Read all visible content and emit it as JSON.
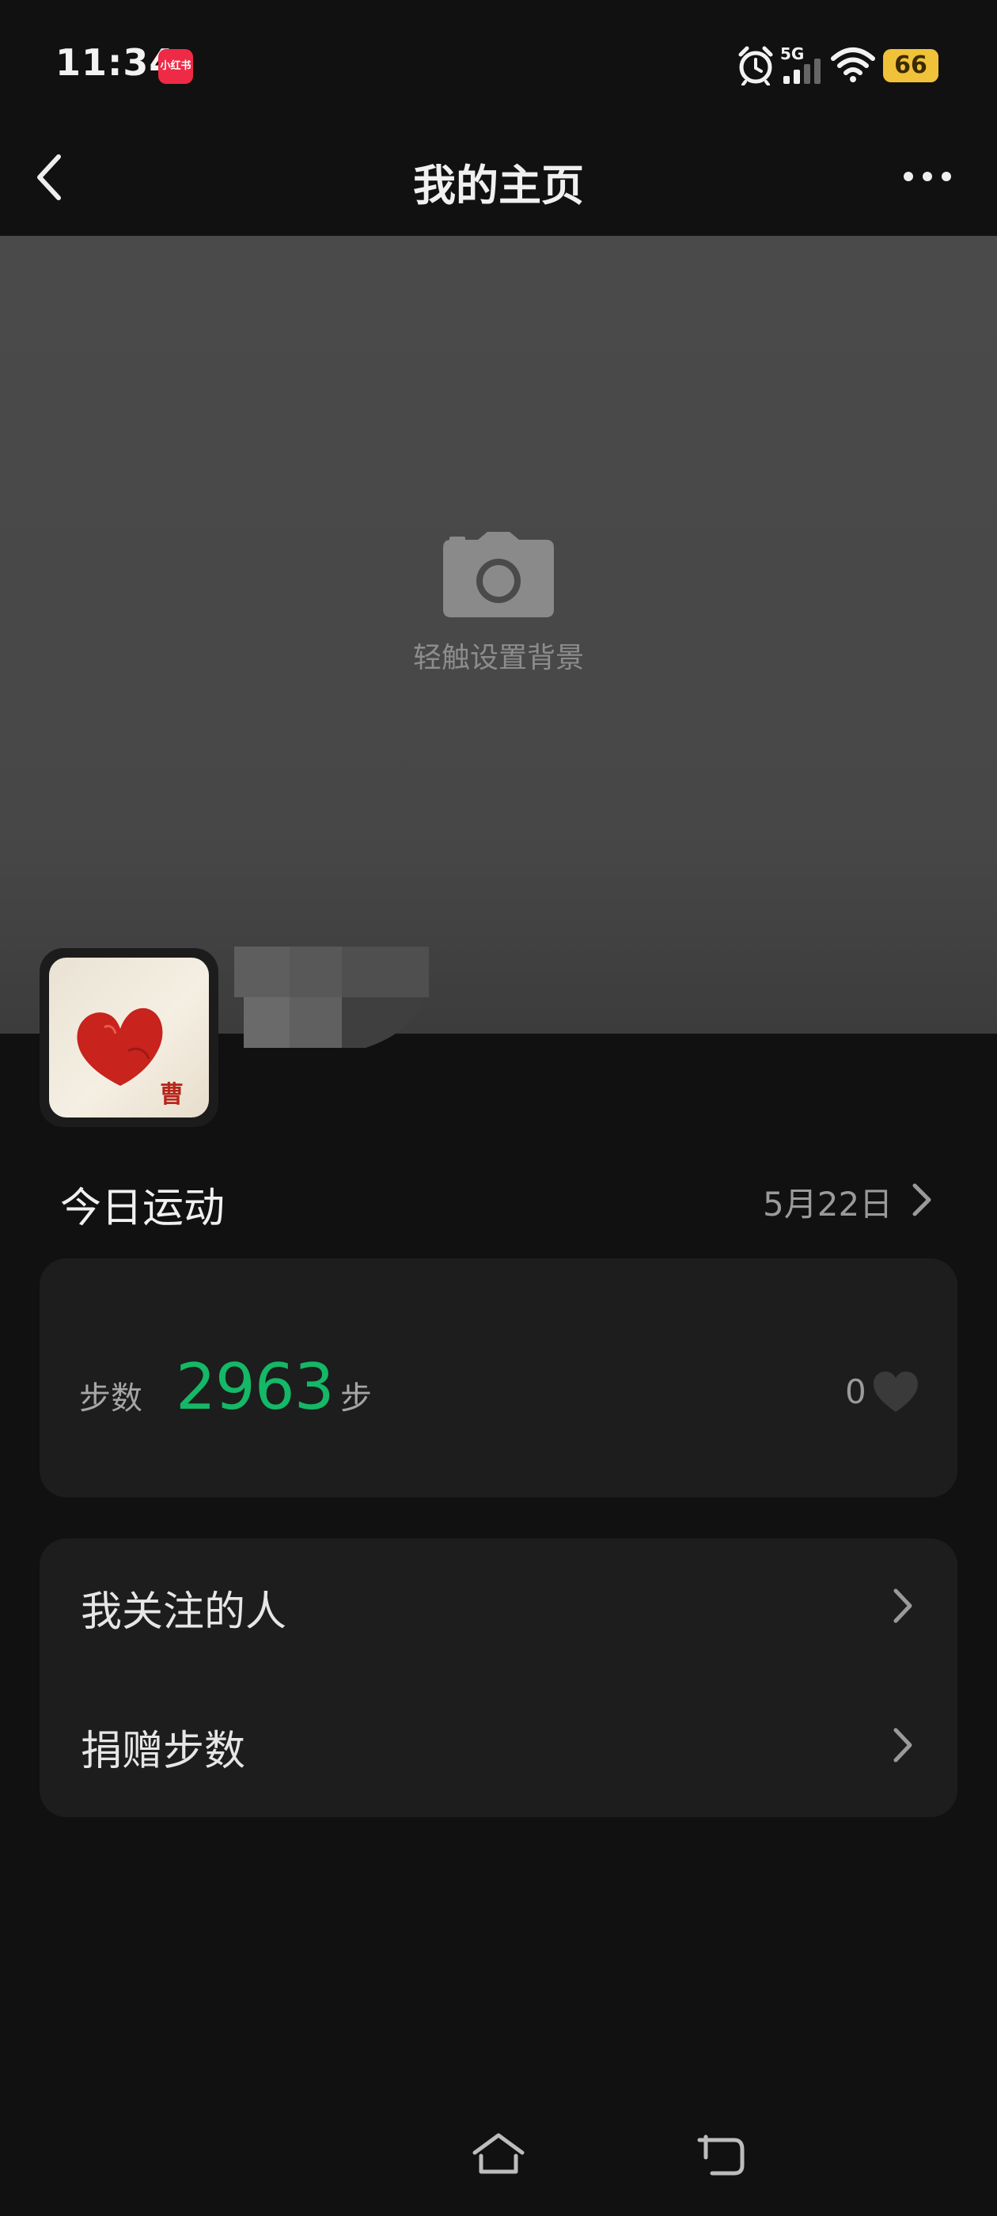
{
  "status_bar": {
    "time": "11:34",
    "app_badge": "小红书",
    "network": "5G",
    "battery": "66",
    "icons": [
      "alarm-icon",
      "signal-icon",
      "wifi-icon",
      "battery-icon"
    ]
  },
  "nav": {
    "title": "我的主页",
    "back_icon": "chevron-left-icon",
    "more_icon": "more-horizontal-icon"
  },
  "cover": {
    "hint": "轻触设置背景",
    "icon": "camera-icon"
  },
  "profile": {
    "avatar_seal": "曹"
  },
  "today": {
    "title": "今日运动",
    "date": "5月22日",
    "steps_label": "步数",
    "steps_value": "2963",
    "steps_unit": "步",
    "likes": "0"
  },
  "menu": {
    "items": [
      {
        "label": "我关注的人"
      },
      {
        "label": "捐赠步数"
      }
    ]
  },
  "colors": {
    "accent_green": "#14b866",
    "background": "#111111",
    "card": "#1d1d1d",
    "battery": "#f0c23a",
    "app_badge": "#ee2a47"
  },
  "system_nav": {
    "icons": [
      "home-icon",
      "back-icon"
    ]
  }
}
